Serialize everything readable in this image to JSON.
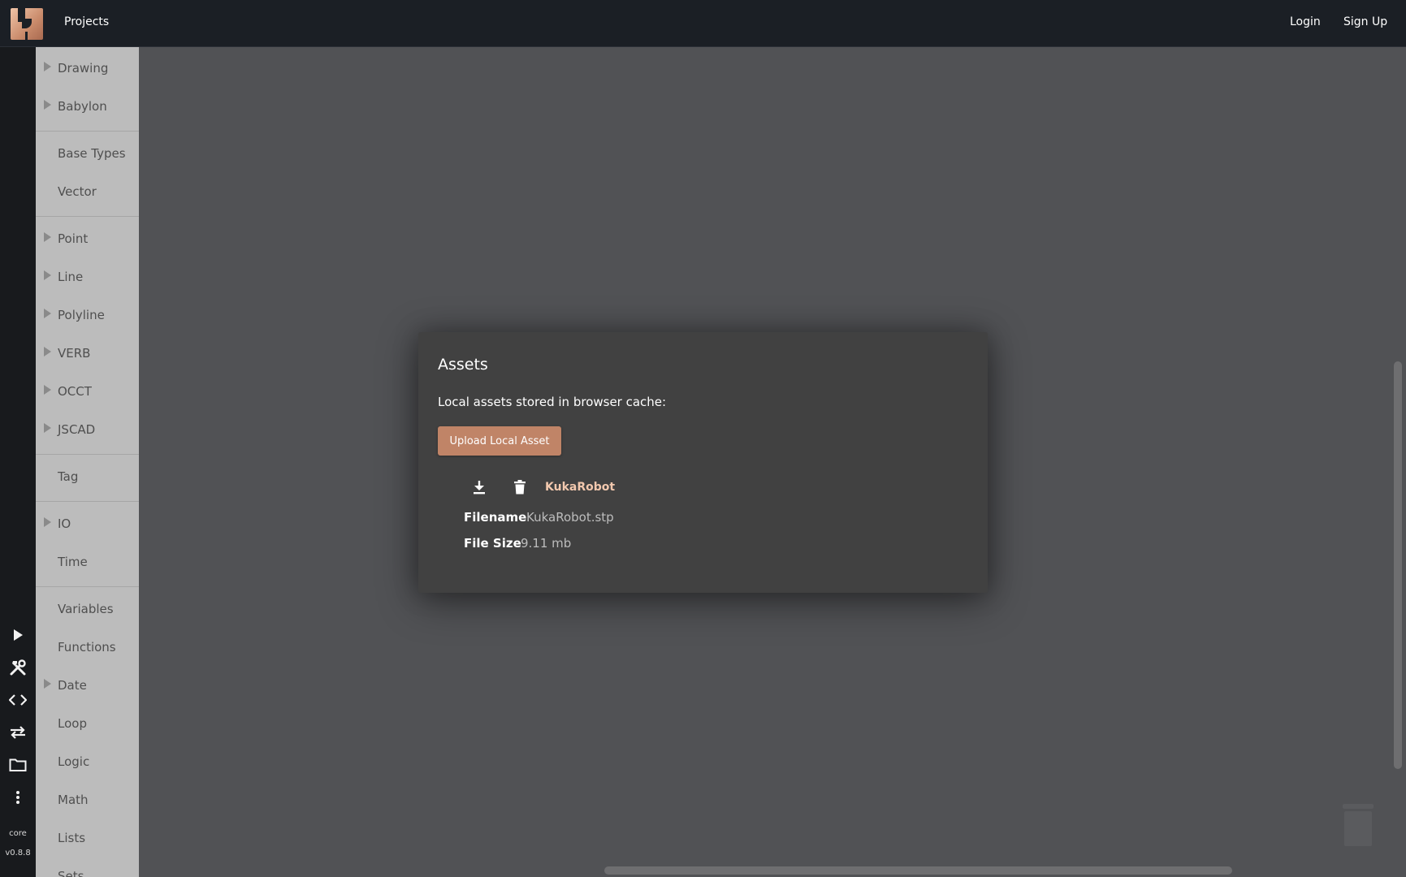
{
  "topbar": {
    "projects_label": "Projects",
    "login_label": "Login",
    "signup_label": "Sign Up"
  },
  "left_rail": {
    "icons": [
      "play-icon",
      "tools-icon",
      "code-icon",
      "swap-icon",
      "folder-icon",
      "more-vertical-icon"
    ],
    "core_label": "core",
    "version_label": "v0.8.8"
  },
  "sidebar": {
    "items": [
      {
        "label": "Drawing",
        "expandable": true
      },
      {
        "label": "Babylon",
        "expandable": true
      },
      {
        "label": "Base Types",
        "expandable": false
      },
      {
        "label": "Vector",
        "expandable": false
      },
      {
        "label": "Point",
        "expandable": true
      },
      {
        "label": "Line",
        "expandable": true
      },
      {
        "label": "Polyline",
        "expandable": true
      },
      {
        "label": "VERB",
        "expandable": true
      },
      {
        "label": "OCCT",
        "expandable": true
      },
      {
        "label": "JSCAD",
        "expandable": true
      },
      {
        "label": "Tag",
        "expandable": false
      },
      {
        "label": "IO",
        "expandable": true
      },
      {
        "label": "Time",
        "expandable": false
      },
      {
        "label": "Variables",
        "expandable": false
      },
      {
        "label": "Functions",
        "expandable": false
      },
      {
        "label": "Date",
        "expandable": true
      },
      {
        "label": "Loop",
        "expandable": false
      },
      {
        "label": "Logic",
        "expandable": false
      },
      {
        "label": "Math",
        "expandable": false
      },
      {
        "label": "Lists",
        "expandable": false
      },
      {
        "label": "Sets",
        "expandable": false
      }
    ]
  },
  "dialog": {
    "title": "Assets",
    "description": "Local assets stored in browser cache:",
    "upload_label": "Upload Local Asset",
    "asset": {
      "name": "KukaRobot",
      "filename_key": "Filename",
      "filename_value": "KukaRobot.stp",
      "filesize_key": "File Size",
      "filesize_value": "9.11 mb"
    }
  },
  "colors": {
    "topbar_bg": "#1b1f25",
    "sidebar_bg": "#bcbcbc",
    "workspace_bg": "#515255",
    "dialog_bg": "#414141",
    "accent": "#c08467",
    "asset_name": "#f2c8ae"
  }
}
